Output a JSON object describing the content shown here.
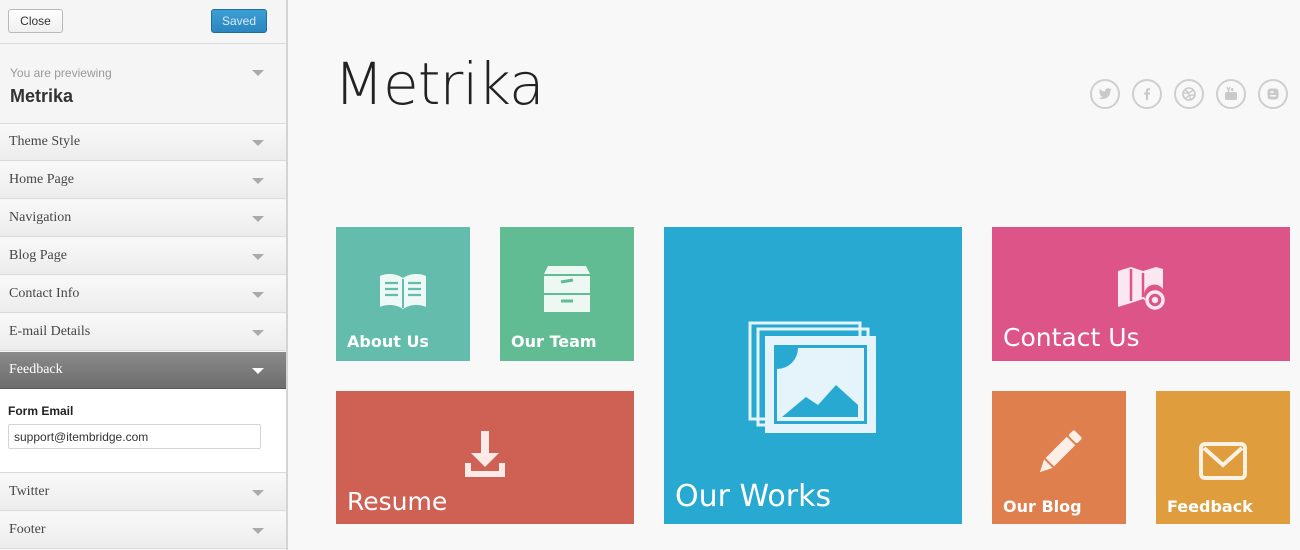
{
  "sidebar": {
    "close_label": "Close",
    "saved_label": "Saved",
    "previewing_label": "You are previewing",
    "theme_name": "Metrika",
    "sections": [
      {
        "label": "Theme Style"
      },
      {
        "label": "Home Page"
      },
      {
        "label": "Navigation"
      },
      {
        "label": "Blog Page"
      },
      {
        "label": "Contact Info"
      },
      {
        "label": "E-mail Details"
      },
      {
        "label": "Feedback"
      },
      {
        "label": "Twitter"
      },
      {
        "label": "Footer"
      }
    ],
    "feedback": {
      "field_label": "Form Email",
      "field_value": "support@itembridge.com"
    }
  },
  "site": {
    "title": "Metrika",
    "social_icons": [
      "twitter-icon",
      "facebook-icon",
      "dribbble-icon",
      "youtube-icon",
      "blogger-icon"
    ],
    "tiles": [
      {
        "label": "About Us",
        "icon": "book-icon",
        "color": "#63bcac"
      },
      {
        "label": "Our Team",
        "icon": "archive-icon",
        "color": "#61bb93"
      },
      {
        "label": "Our Works",
        "icon": "gallery-icon",
        "color": "#27a9d2"
      },
      {
        "label": "Contact Us",
        "icon": "map-icon",
        "color": "#dc5488"
      },
      {
        "label": "Resume",
        "icon": "download-icon",
        "color": "#ce6153"
      },
      {
        "label": "Our Blog",
        "icon": "pencil-icon",
        "color": "#df7f4d"
      },
      {
        "label": "Feedback",
        "icon": "envelope-icon",
        "color": "#e09d3d"
      }
    ]
  }
}
